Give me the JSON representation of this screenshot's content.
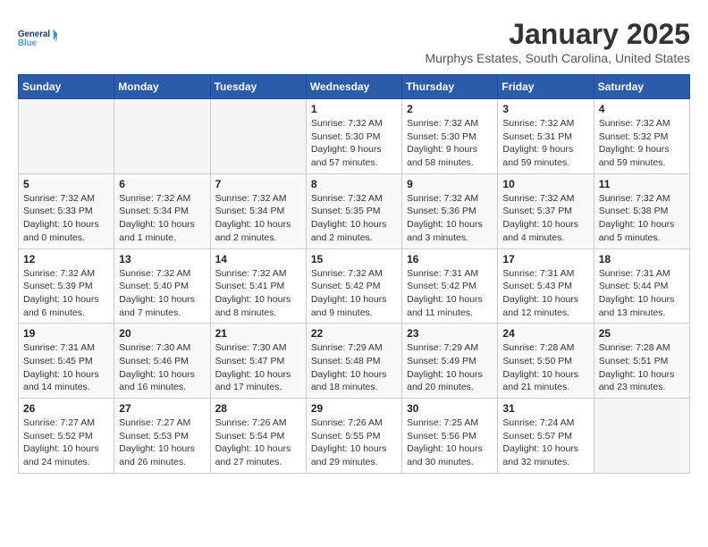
{
  "logo": {
    "line1": "General",
    "line2": "Blue"
  },
  "title": "January 2025",
  "location": "Murphys Estates, South Carolina, United States",
  "weekdays": [
    "Sunday",
    "Monday",
    "Tuesday",
    "Wednesday",
    "Thursday",
    "Friday",
    "Saturday"
  ],
  "weeks": [
    [
      {
        "day": "",
        "info": ""
      },
      {
        "day": "",
        "info": ""
      },
      {
        "day": "",
        "info": ""
      },
      {
        "day": "1",
        "info": "Sunrise: 7:32 AM\nSunset: 5:30 PM\nDaylight: 9 hours\nand 57 minutes."
      },
      {
        "day": "2",
        "info": "Sunrise: 7:32 AM\nSunset: 5:30 PM\nDaylight: 9 hours\nand 58 minutes."
      },
      {
        "day": "3",
        "info": "Sunrise: 7:32 AM\nSunset: 5:31 PM\nDaylight: 9 hours\nand 59 minutes."
      },
      {
        "day": "4",
        "info": "Sunrise: 7:32 AM\nSunset: 5:32 PM\nDaylight: 9 hours\nand 59 minutes."
      }
    ],
    [
      {
        "day": "5",
        "info": "Sunrise: 7:32 AM\nSunset: 5:33 PM\nDaylight: 10 hours\nand 0 minutes."
      },
      {
        "day": "6",
        "info": "Sunrise: 7:32 AM\nSunset: 5:34 PM\nDaylight: 10 hours\nand 1 minute."
      },
      {
        "day": "7",
        "info": "Sunrise: 7:32 AM\nSunset: 5:34 PM\nDaylight: 10 hours\nand 2 minutes."
      },
      {
        "day": "8",
        "info": "Sunrise: 7:32 AM\nSunset: 5:35 PM\nDaylight: 10 hours\nand 2 minutes."
      },
      {
        "day": "9",
        "info": "Sunrise: 7:32 AM\nSunset: 5:36 PM\nDaylight: 10 hours\nand 3 minutes."
      },
      {
        "day": "10",
        "info": "Sunrise: 7:32 AM\nSunset: 5:37 PM\nDaylight: 10 hours\nand 4 minutes."
      },
      {
        "day": "11",
        "info": "Sunrise: 7:32 AM\nSunset: 5:38 PM\nDaylight: 10 hours\nand 5 minutes."
      }
    ],
    [
      {
        "day": "12",
        "info": "Sunrise: 7:32 AM\nSunset: 5:39 PM\nDaylight: 10 hours\nand 6 minutes."
      },
      {
        "day": "13",
        "info": "Sunrise: 7:32 AM\nSunset: 5:40 PM\nDaylight: 10 hours\nand 7 minutes."
      },
      {
        "day": "14",
        "info": "Sunrise: 7:32 AM\nSunset: 5:41 PM\nDaylight: 10 hours\nand 8 minutes."
      },
      {
        "day": "15",
        "info": "Sunrise: 7:32 AM\nSunset: 5:42 PM\nDaylight: 10 hours\nand 9 minutes."
      },
      {
        "day": "16",
        "info": "Sunrise: 7:31 AM\nSunset: 5:42 PM\nDaylight: 10 hours\nand 11 minutes."
      },
      {
        "day": "17",
        "info": "Sunrise: 7:31 AM\nSunset: 5:43 PM\nDaylight: 10 hours\nand 12 minutes."
      },
      {
        "day": "18",
        "info": "Sunrise: 7:31 AM\nSunset: 5:44 PM\nDaylight: 10 hours\nand 13 minutes."
      }
    ],
    [
      {
        "day": "19",
        "info": "Sunrise: 7:31 AM\nSunset: 5:45 PM\nDaylight: 10 hours\nand 14 minutes."
      },
      {
        "day": "20",
        "info": "Sunrise: 7:30 AM\nSunset: 5:46 PM\nDaylight: 10 hours\nand 16 minutes."
      },
      {
        "day": "21",
        "info": "Sunrise: 7:30 AM\nSunset: 5:47 PM\nDaylight: 10 hours\nand 17 minutes."
      },
      {
        "day": "22",
        "info": "Sunrise: 7:29 AM\nSunset: 5:48 PM\nDaylight: 10 hours\nand 18 minutes."
      },
      {
        "day": "23",
        "info": "Sunrise: 7:29 AM\nSunset: 5:49 PM\nDaylight: 10 hours\nand 20 minutes."
      },
      {
        "day": "24",
        "info": "Sunrise: 7:28 AM\nSunset: 5:50 PM\nDaylight: 10 hours\nand 21 minutes."
      },
      {
        "day": "25",
        "info": "Sunrise: 7:28 AM\nSunset: 5:51 PM\nDaylight: 10 hours\nand 23 minutes."
      }
    ],
    [
      {
        "day": "26",
        "info": "Sunrise: 7:27 AM\nSunset: 5:52 PM\nDaylight: 10 hours\nand 24 minutes."
      },
      {
        "day": "27",
        "info": "Sunrise: 7:27 AM\nSunset: 5:53 PM\nDaylight: 10 hours\nand 26 minutes."
      },
      {
        "day": "28",
        "info": "Sunrise: 7:26 AM\nSunset: 5:54 PM\nDaylight: 10 hours\nand 27 minutes."
      },
      {
        "day": "29",
        "info": "Sunrise: 7:26 AM\nSunset: 5:55 PM\nDaylight: 10 hours\nand 29 minutes."
      },
      {
        "day": "30",
        "info": "Sunrise: 7:25 AM\nSunset: 5:56 PM\nDaylight: 10 hours\nand 30 minutes."
      },
      {
        "day": "31",
        "info": "Sunrise: 7:24 AM\nSunset: 5:57 PM\nDaylight: 10 hours\nand 32 minutes."
      },
      {
        "day": "",
        "info": ""
      }
    ]
  ]
}
